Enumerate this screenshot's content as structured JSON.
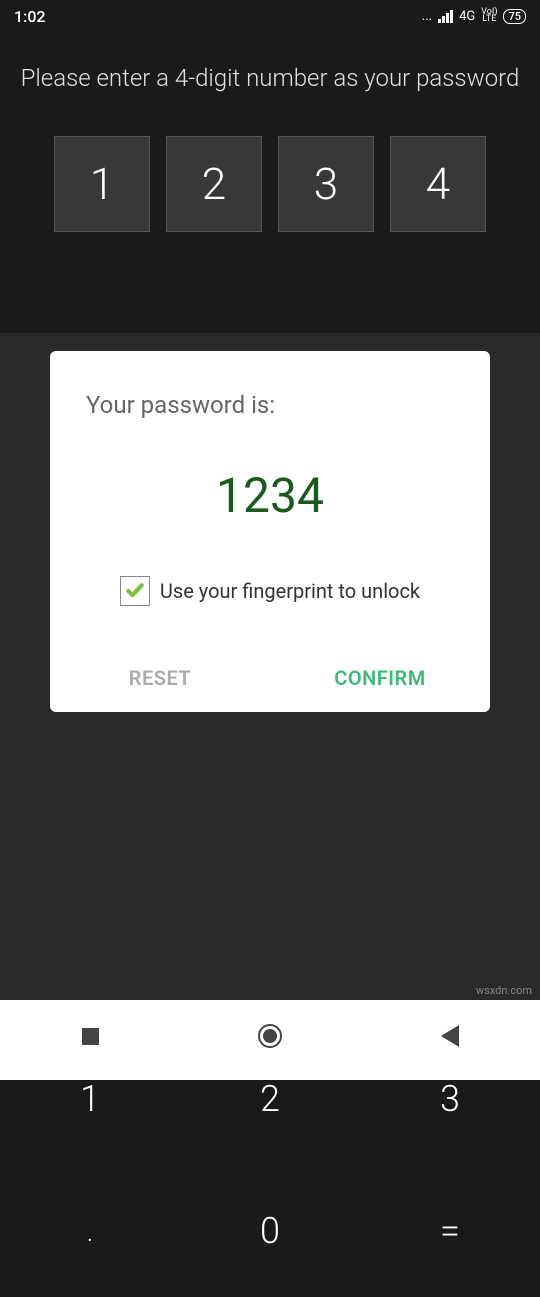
{
  "status": {
    "time": "1:02",
    "dots": "...",
    "network": "4G",
    "volte_top": "VoI)",
    "volte_bot": "LTE",
    "battery": "75"
  },
  "prompt": "Please enter a 4-digit number as your password",
  "digits": [
    "1",
    "2",
    "3",
    "4"
  ],
  "card": {
    "title": "Your password is:",
    "password": "1234",
    "fingerprint_label": "Use your fingerprint to unlock",
    "reset": "RESET",
    "confirm": "CONFIRM"
  },
  "keypad": {
    "k1": "1",
    "k2": "2",
    "k3": "3",
    "k4": ".",
    "k5": "0",
    "k6": "="
  },
  "watermark": "wsxdn.com"
}
